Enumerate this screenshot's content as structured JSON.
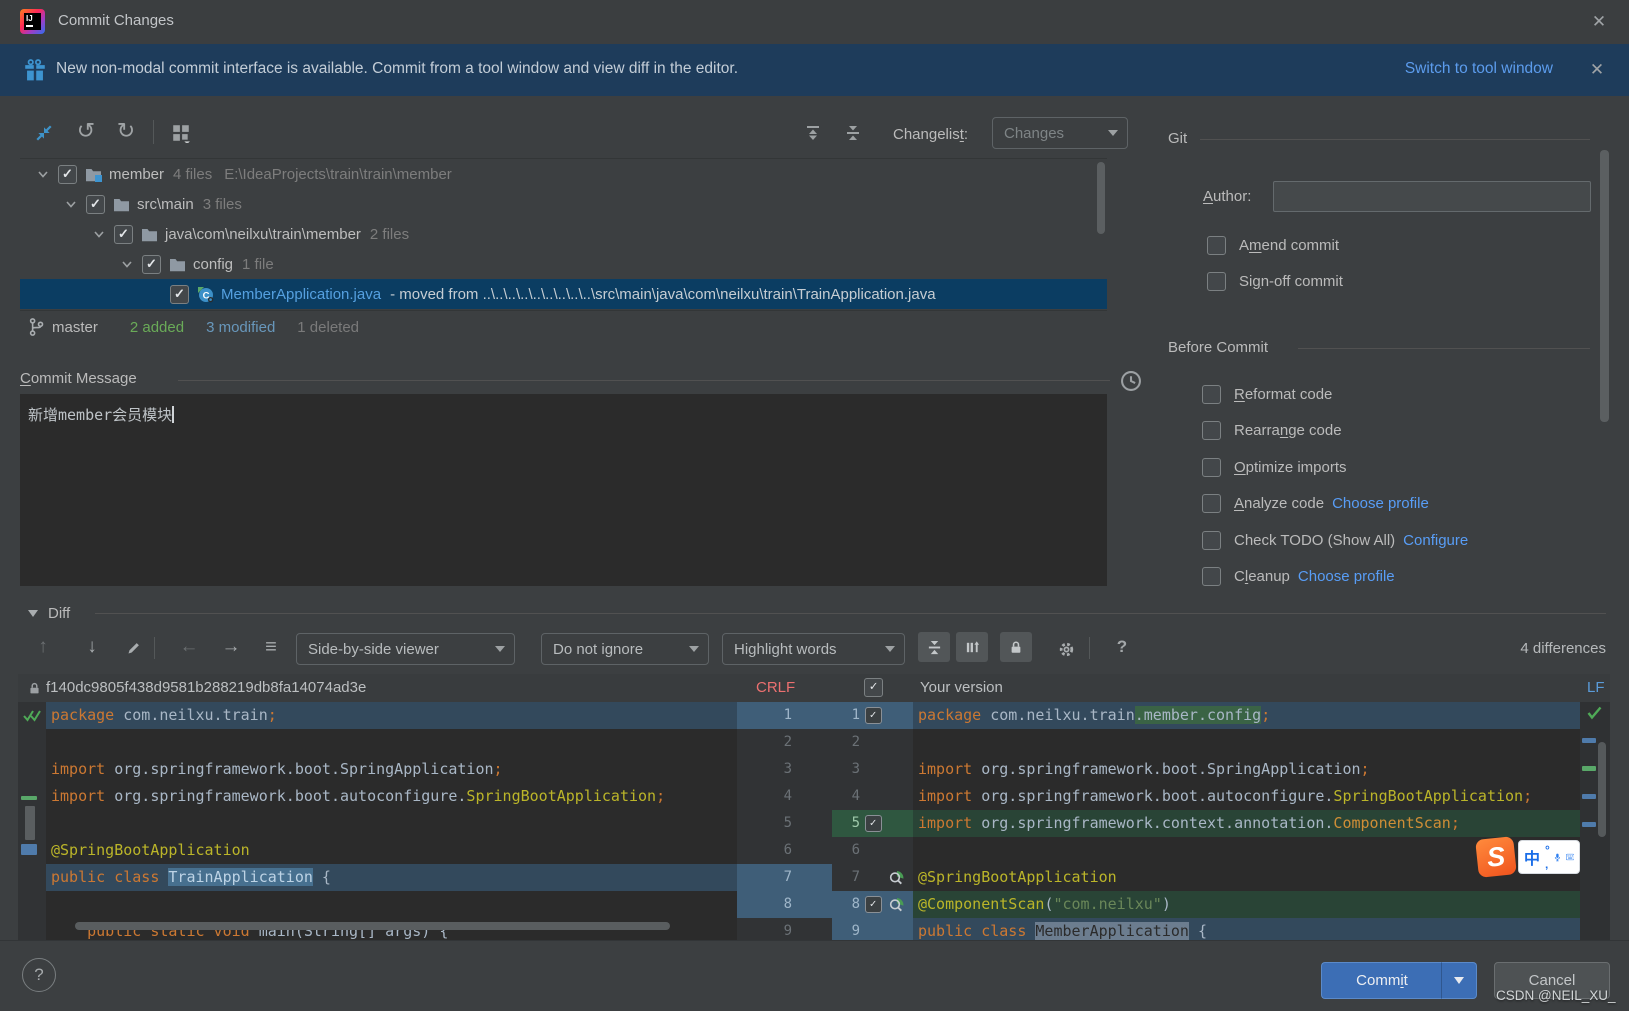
{
  "window": {
    "title": "Commit Changes",
    "close": "✕"
  },
  "banner": {
    "message": "New non-modal commit interface is available. Commit from a tool window and view diff in the editor.",
    "action": "Switch to tool window",
    "close": "✕"
  },
  "toolbar": {
    "changelist_label": "Changelist:",
    "changelist_value": "Changes"
  },
  "tree": {
    "rows": [
      {
        "name": "member",
        "meta": "4 files",
        "path": "E:\\IdeaProjects\\train\\train\\member",
        "indent": 0,
        "kind": "module",
        "checked": true
      },
      {
        "name": "src\\main",
        "meta": "3 files",
        "path": "",
        "indent": 1,
        "kind": "folder",
        "checked": true
      },
      {
        "name": "java\\com\\neilxu\\train\\member",
        "meta": "2 files",
        "path": "",
        "indent": 2,
        "kind": "folder",
        "checked": true
      },
      {
        "name": "config",
        "meta": "1 file",
        "path": "",
        "indent": 3,
        "kind": "folder",
        "checked": true
      },
      {
        "name": "MemberApplication.java",
        "meta": "- moved from ..\\..\\..\\..\\..\\..\\..\\..\\..\\src\\main\\java\\com\\neilxu\\train\\TrainApplication.java",
        "path": "",
        "indent": 4,
        "kind": "file",
        "checked": true,
        "selected": true
      }
    ]
  },
  "branch": {
    "name": "master",
    "added": "2 added",
    "modified": "3 modified",
    "deleted": "1 deleted"
  },
  "commit": {
    "label": "Commit Message",
    "value": "新增member会员模块"
  },
  "git": {
    "title": "Git",
    "author_label": "Author:",
    "author_value": "",
    "checks": [
      {
        "label": "Amend commit",
        "u": 1,
        "checked": false
      },
      {
        "label": "Sign-off commit",
        "u": 2,
        "checked": false
      }
    ]
  },
  "before": {
    "title": "Before Commit",
    "items": [
      {
        "label": "Reformat code",
        "u": 0,
        "checked": false
      },
      {
        "label": "Rearrange code",
        "u": 6,
        "checked": false
      },
      {
        "label": "Optimize imports",
        "u": 0,
        "checked": false
      },
      {
        "label": "Analyze code",
        "u": 0,
        "checked": false,
        "link": "Choose profile"
      },
      {
        "label": "Check TODO (Show All)",
        "checked": false,
        "link": "Configure"
      },
      {
        "label": "Cleanup",
        "u": 1,
        "checked": false,
        "link": "Choose profile"
      }
    ]
  },
  "diff": {
    "section_label": "Diff",
    "toolbar": {
      "viewer": "Side-by-side viewer",
      "ignore": "Do not ignore",
      "highlight": "Highlight words",
      "differences": "4 differences",
      "help": "?"
    },
    "left_header": {
      "title": "f140dc9805f438d9581b288219db8fa14074ad3e",
      "ending": "CRLF"
    },
    "right_header": {
      "title": "Your version",
      "ending": "LF"
    },
    "rows": [
      {
        "ln": 1,
        "rn": 1,
        "lnc": "chg",
        "rnc": "chg",
        "chk": true,
        "lb": "chg",
        "l": [
          [
            "k",
            "package "
          ],
          [
            "p",
            "com.neilxu.train"
          ],
          [
            "k",
            ";"
          ]
        ],
        "rb": "chg",
        "r": [
          [
            "k",
            "package "
          ],
          [
            "p",
            "com.neilxu.train"
          ],
          [
            "wa",
            ".member.config"
          ],
          [
            "k",
            ";"
          ]
        ]
      },
      {
        "ln": 2,
        "rn": 2,
        "l": [],
        "r": []
      },
      {
        "ln": 3,
        "rn": 3,
        "l": [
          [
            "k",
            "import "
          ],
          [
            "p",
            "org.springframework.boot.SpringApplication"
          ],
          [
            "k",
            ";"
          ]
        ],
        "r": [
          [
            "k",
            "import "
          ],
          [
            "p",
            "org.springframework.boot.SpringApplication"
          ],
          [
            "k",
            ";"
          ]
        ]
      },
      {
        "ln": 4,
        "rn": 4,
        "l": [
          [
            "k",
            "import "
          ],
          [
            "p",
            "org.springframework.boot.autoconfigure."
          ],
          [
            "a",
            "SpringBootApplication"
          ],
          [
            "k",
            ";"
          ]
        ],
        "r": [
          [
            "k",
            "import "
          ],
          [
            "p",
            "org.springframework.boot.autoconfigure."
          ],
          [
            "a",
            "SpringBootApplication"
          ],
          [
            "k",
            ";"
          ]
        ]
      },
      {
        "ln": 5,
        "rn": 5,
        "rnc": "add",
        "chk": true,
        "l": [],
        "rb": "add",
        "r": [
          [
            "k",
            "import "
          ],
          [
            "p",
            "org.springframework.context.annotation."
          ],
          [
            "o",
            "ComponentScan"
          ],
          [
            "k",
            ";"
          ]
        ]
      },
      {
        "ln": 6,
        "rn": 6,
        "l": [
          [
            "a",
            "@SpringBootApplication"
          ]
        ],
        "r": []
      },
      {
        "ln": 7,
        "rn": 7,
        "lnc": "chg",
        "icon": true,
        "lb": "chg",
        "l": [
          [
            "k",
            "public class "
          ],
          [
            "wb",
            "TrainApplication"
          ],
          [
            "p",
            " {"
          ]
        ],
        "r": [
          [
            "a",
            "@SpringBootApplication"
          ]
        ]
      },
      {
        "ln": 8,
        "rn": 8,
        "lnc": "chg",
        "rnc": "chg",
        "chk": true,
        "icon": true,
        "l": [],
        "rb": "add",
        "r": [
          [
            "a",
            "@ComponentScan"
          ],
          [
            "p",
            "("
          ],
          [
            "s",
            "\"com.neilxu\""
          ],
          [
            "p",
            ")"
          ]
        ]
      },
      {
        "ln": 9,
        "rn": 9,
        "rnc": "chg",
        "l": [
          [
            "k",
            "    public static void "
          ],
          [
            "p",
            "main(String[] args) {"
          ]
        ],
        "rb": "chg",
        "r": [
          [
            "k",
            "public class "
          ],
          [
            "wg",
            "MemberApplication"
          ],
          [
            "p",
            " {"
          ]
        ]
      }
    ]
  },
  "footer": {
    "help": "?",
    "commit": "Commit",
    "cancel": "Cancel",
    "watermark": "CSDN @NEIL_XU_"
  },
  "ime": {
    "logo": "S",
    "lang": "中",
    "punct": "°‚"
  }
}
